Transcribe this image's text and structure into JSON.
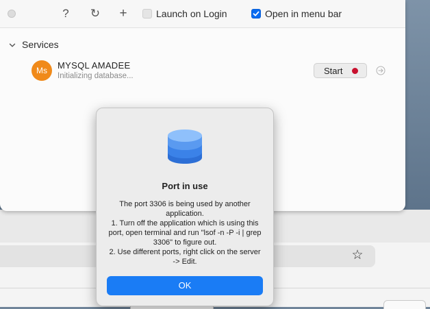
{
  "toolbar": {
    "help_icon": "?",
    "refresh_icon": "↻",
    "add_icon": "+",
    "launch_on_login": {
      "label": "Launch on Login",
      "checked": false
    },
    "open_in_menu_bar": {
      "label": "Open in menu bar",
      "checked": true
    }
  },
  "services": {
    "section_title": "Services",
    "items": [
      {
        "avatar": "Ms",
        "name": "MYSQL AMADEE",
        "status": "Initializing database...",
        "start_label": "Start",
        "status_color": "#c8102e",
        "avatar_color": "#f08a1a"
      }
    ]
  },
  "dialog": {
    "icon": "database-icon",
    "title": "Port in use",
    "message": "The port 3306 is being used by another application.\n1. Turn off the application which is using this port, open terminal and run \"lsof -n -P -i | grep 3306\" to figure out.\n2. Use different ports, right click on the server -> Edit.",
    "ok_label": "OK",
    "accent": "#1a7cf5"
  },
  "background": {
    "star_icon": "☆"
  }
}
